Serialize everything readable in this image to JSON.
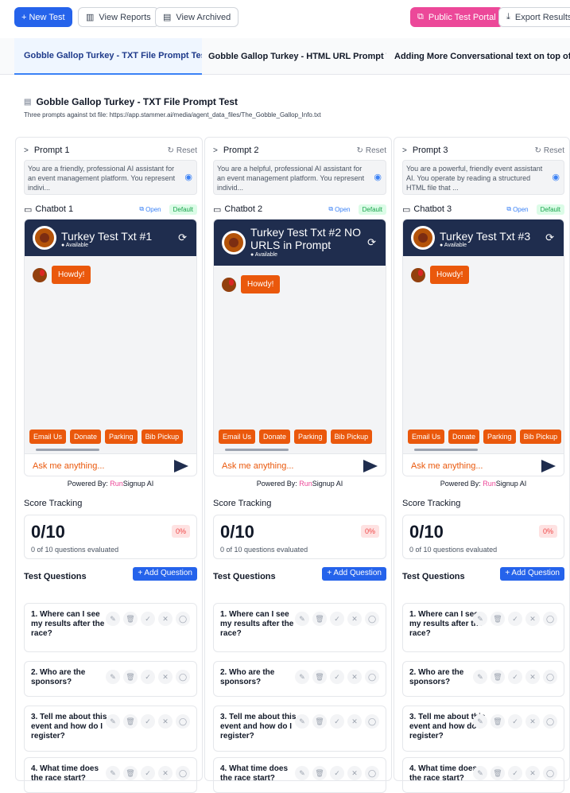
{
  "toolbar": {
    "new_test": "+ New Test",
    "view_reports": "View Reports",
    "view_archived": "View Archived",
    "public_portal": "Public Test Portal",
    "export_results": "Export Results"
  },
  "tabs": [
    {
      "label": "Gobble Gallop Turkey - TXT File Prompt Test"
    },
    {
      "label": "Gobble Gallop Turkey - HTML URL Prompt Test"
    },
    {
      "label": "Adding More Conversational text on top of JSO..."
    }
  ],
  "test": {
    "title": "Gobble Gallop Turkey - TXT File Prompt Test",
    "description": "Three prompts against txt file: https://app.stammer.ai/media/agent_data_files/The_Gobble_Gallop_Info.txt"
  },
  "columns": [
    {
      "prompt_title": "Prompt 1",
      "reset": "Reset",
      "prompt_text": "You are a friendly, professional AI assistant for an event management platform. You represent indivi...",
      "chatbot_title": "Chatbot 1",
      "open": "Open",
      "default": "Default",
      "bot_name": "Turkey Test Txt #1",
      "available": "Available",
      "greeting": "Howdy!",
      "quick": [
        "Email Us",
        "Donate",
        "Parking",
        "Bib Pickup"
      ],
      "ask": "Ask me anything...",
      "powered_prefix": "Powered By: ",
      "powered_run": "Run",
      "powered_suffix": "Signup AI",
      "score_tracking": "Score Tracking",
      "score": "0/10",
      "score_sub": "0 of 10 questions evaluated",
      "pct": "0%",
      "test_questions": "Test Questions",
      "add_question": "+ Add Question"
    },
    {
      "prompt_title": "Prompt 2",
      "reset": "Reset",
      "prompt_text": "You are a helpful, professional AI assistant for an event management platform. You represent individ...",
      "chatbot_title": "Chatbot 2",
      "open": "Open",
      "default": "Default",
      "bot_name": "Turkey Test Txt #2 NO URLS in Prompt",
      "available": "Available",
      "greeting": "Howdy!",
      "quick": [
        "Email Us",
        "Donate",
        "Parking",
        "Bib Pickup"
      ],
      "ask": "Ask me anything...",
      "powered_prefix": "Powered By: ",
      "powered_run": "Run",
      "powered_suffix": "Signup AI",
      "score_tracking": "Score Tracking",
      "score": "0/10",
      "score_sub": "0 of 10 questions evaluated",
      "pct": "0%",
      "test_questions": "Test Questions",
      "add_question": "+ Add Question"
    },
    {
      "prompt_title": "Prompt 3",
      "reset": "Reset",
      "prompt_text": "You are a powerful, friendly event assistant AI. You operate by reading a structured HTML file that ...",
      "chatbot_title": "Chatbot 3",
      "open": "Open",
      "default": "Default",
      "bot_name": "Turkey Test Txt #3",
      "available": "Available",
      "greeting": "Howdy!",
      "quick": [
        "Email Us",
        "Donate",
        "Parking",
        "Bib Pickup"
      ],
      "ask": "Ask me anything...",
      "powered_prefix": "Powered By: ",
      "powered_run": "Run",
      "powered_suffix": "Signup AI",
      "score_tracking": "Score Tracking",
      "score": "0/10",
      "score_sub": "0 of 10 questions evaluated",
      "pct": "0%",
      "test_questions": "Test Questions",
      "add_question": "+ Add Question"
    }
  ],
  "questions": [
    "1. Where can I see my results after the race?",
    "2. Who are the sponsors?",
    "3. Tell me about this event and how do I register?",
    "4. What time does the race start?"
  ],
  "colors": {
    "accent": "#2563eb",
    "pink": "#ec4899",
    "orange": "#ea580c",
    "navy": "#1f2d4e"
  }
}
